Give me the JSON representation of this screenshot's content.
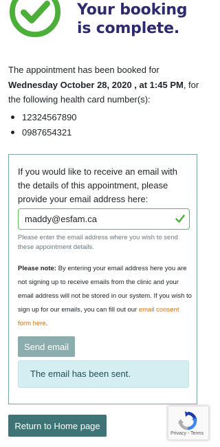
{
  "header": {
    "title": "Your booking is complete."
  },
  "confirmation": {
    "prefix": "The appointment has been booked for ",
    "date_time": "Wednesday October 28, 2020 , at 1:45 PM",
    "suffix": ", for the following health card number(s):",
    "health_card_numbers": [
      "12324567890",
      "0987654321"
    ]
  },
  "email_panel": {
    "prompt": "If you would like to receive an email with the details of this appointment, please provide your email address here:",
    "email_value": "maddy@esfam.ca",
    "help_text": "Please enter the email address where you wish to send these appointment details.",
    "note_label": "Please note:",
    "note_text": " By entering your email address here you are not signing up to receive emails from the clinic and your email address will not be stored in our system. If you wish to sign up for our emails, you can fill out our ",
    "consent_link_text": "email consent form here",
    "note_end": ".",
    "send_button_label": "Send email",
    "sent_message": "The email has been sent."
  },
  "footer": {
    "home_button_label": "Return to Home page"
  },
  "recaptcha": {
    "links_text": "Privacy - Terms"
  },
  "colors": {
    "title": "#2d2a6e",
    "success_green": "#5cb85c",
    "check_icon": "#4caf3a",
    "link_orange": "#c8741e",
    "send_button": "#8cadae",
    "home_button": "#3f7476",
    "alert_background": "#d4eef2"
  },
  "icons": {
    "success": "check-circle-icon",
    "input_valid": "check-icon",
    "recaptcha": "recaptcha-icon"
  }
}
